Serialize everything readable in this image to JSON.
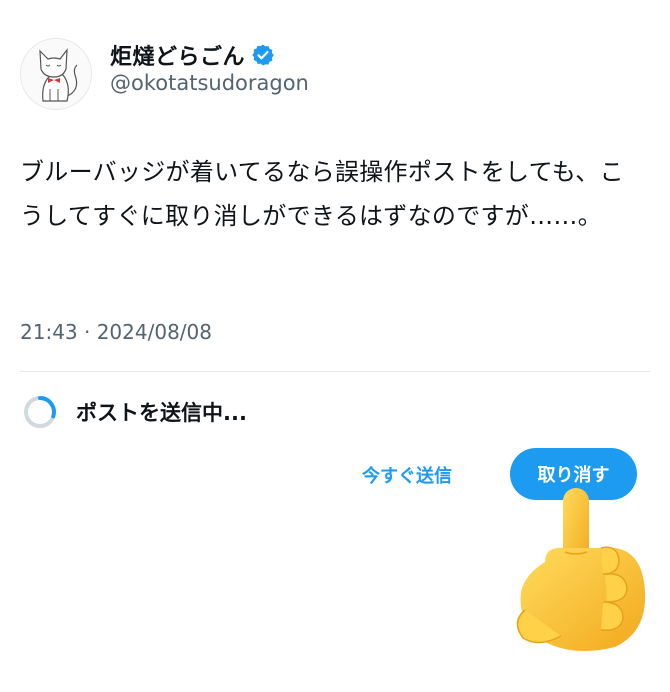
{
  "author": {
    "display_name": "炬燵どらごん",
    "handle": "@okotatsudoragon"
  },
  "tweet": {
    "text": "ブルーバッジが着いてるなら誤操作ポストをしても、こうしてすぐに取り消しができるはずなのですが……。",
    "timestamp": "21:43 · 2024/08/08"
  },
  "status": {
    "sending_label": "ポストを送信中..."
  },
  "actions": {
    "send_now_label": "今すぐ送信",
    "undo_label": "取り消す"
  },
  "icons": {
    "verified": "verified-badge-icon",
    "spinner": "loading-spinner-icon",
    "hand": "pointing-hand-emoji"
  },
  "colors": {
    "accent": "#1d9bf0",
    "secondary_text": "#536471"
  }
}
